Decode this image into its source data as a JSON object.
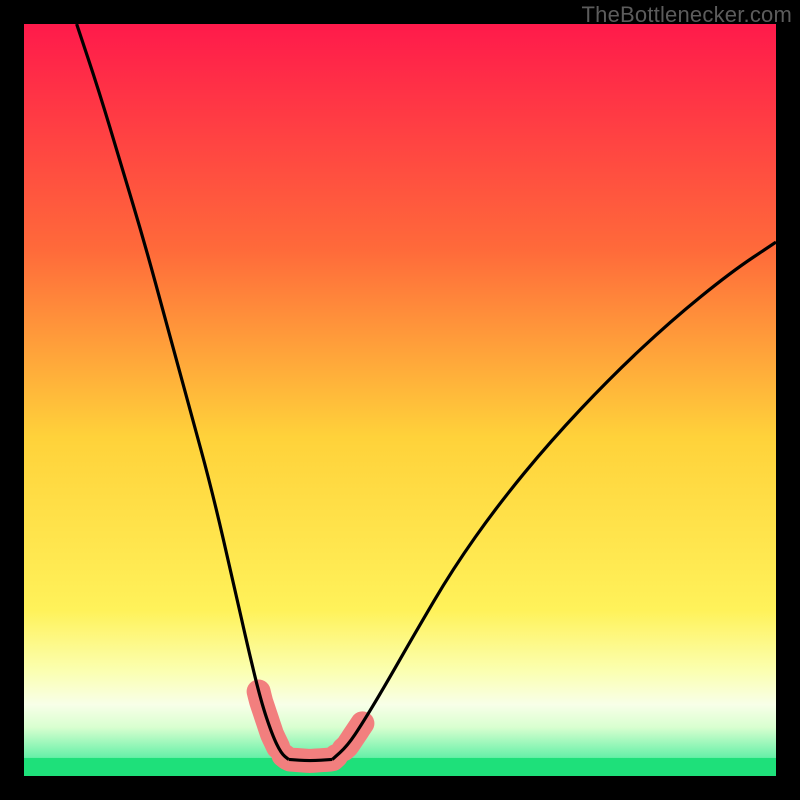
{
  "watermark": "TheBottlenecker.com",
  "colors": {
    "frame": "#000000",
    "curve_stroke": "#000000",
    "salmon_band": "#f27f7e",
    "green_strip": "#1ee07a",
    "watermark_text": "#5c5c5c",
    "gradient_stops": [
      {
        "offset": 0,
        "color": "#ff1a4b"
      },
      {
        "offset": 0.3,
        "color": "#ff6a3a"
      },
      {
        "offset": 0.55,
        "color": "#ffd23a"
      },
      {
        "offset": 0.78,
        "color": "#fff25a"
      },
      {
        "offset": 0.86,
        "color": "#fbffb0"
      },
      {
        "offset": 0.905,
        "color": "#f8ffe8"
      },
      {
        "offset": 0.935,
        "color": "#d9ffd0"
      },
      {
        "offset": 0.975,
        "color": "#67f0a8"
      },
      {
        "offset": 1.0,
        "color": "#1ee07a"
      }
    ]
  },
  "chart_data": {
    "type": "line",
    "title": "",
    "xlabel": "",
    "ylabel": "",
    "xlim": [
      0,
      100
    ],
    "ylim": [
      0,
      100
    ],
    "legend": false,
    "grid": false,
    "series": [
      {
        "name": "left-curve",
        "x": [
          7,
          10,
          13,
          16,
          19,
          22,
          25,
          28,
          29.8,
          31.5,
          33.0,
          34.2,
          35.2
        ],
        "y": [
          100,
          91,
          81,
          71,
          60,
          49,
          38,
          25,
          17,
          10,
          5.5,
          3.0,
          2.2
        ],
        "note": "y ≈ percent height from bottom of plot area; estimated from pixels"
      },
      {
        "name": "valley-floor",
        "x": [
          35.2,
          38.0,
          41.0
        ],
        "y": [
          2.2,
          2.0,
          2.2
        ]
      },
      {
        "name": "right-curve",
        "x": [
          41.0,
          43.0,
          45.0,
          48.0,
          52.0,
          57.0,
          63.0,
          70.0,
          78.0,
          86.0,
          94.0,
          100.0
        ],
        "y": [
          2.2,
          4.0,
          7.0,
          12.0,
          19.0,
          27.5,
          36.0,
          44.5,
          53.0,
          60.5,
          67.0,
          71.0
        ]
      }
    ],
    "annotations": {
      "valley_bottom_x_range_pct": [
        33.0,
        43.0
      ],
      "salmon_overlay_segments_x_pct": [
        [
          31.2,
          33.8
        ],
        [
          34.5,
          41.5
        ],
        [
          42.5,
          45.0
        ]
      ],
      "green_strip_y_range_pct": [
        0.0,
        2.4
      ],
      "description": "Two black curves descending into a V-shaped valley over a vertical red→yellow→pale→green gradient; salmon-colored blobs mark where curves dip into the bottom band; thin bright-green strip at the very bottom."
    }
  }
}
